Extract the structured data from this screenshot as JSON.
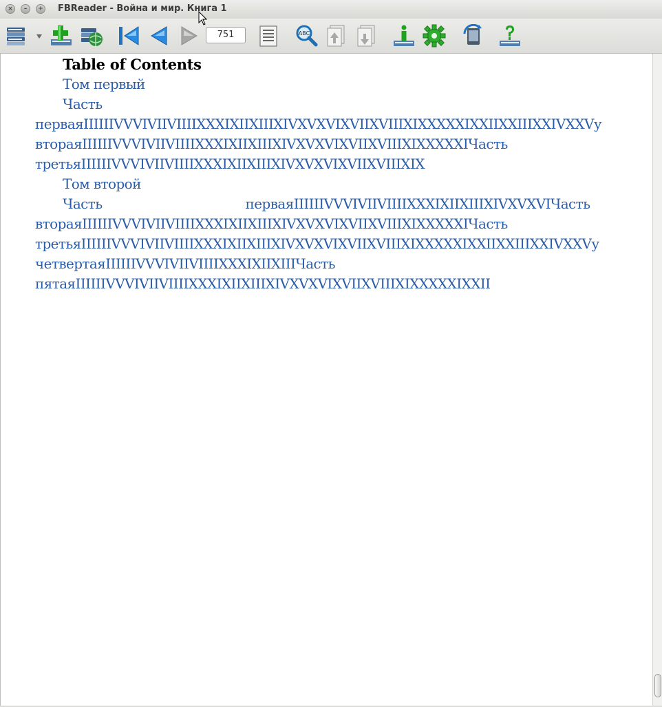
{
  "window": {
    "title": "FBReader - Война и мир. Книга 1",
    "close_glyph": "×",
    "minimize_glyph": "–",
    "maximize_glyph": "+"
  },
  "toolbar": {
    "page_number": "751",
    "icons": [
      "library-icon",
      "menu-arrow-icon",
      "add-book-icon",
      "network-library-icon",
      "go-to-start-icon",
      "back-icon",
      "forward-icon",
      "toc-icon",
      "search-icon",
      "page-up-icon",
      "page-down-icon",
      "book-info-icon",
      "preferences-icon",
      "rotate-icon",
      "help-icon"
    ]
  },
  "toc": {
    "heading": "Table of Contents",
    "tom1": "Том первый",
    "chast": "Часть",
    "l1": "перваяIIIIIIVVVIVIIVIIIIXXXIXIIXIIIXIVXVXVIXVIIXVIIIXIXXXXXIXXIIXXIIIXXIVXXVу",
    "l2": "втораяIIIIIIVVVIVIIVIIIIXXXIXIIXIIIXIVXVXVIXVIIXVIIIXIXXXXXIЧасть",
    "l3": "третьяIIIIIIVVVIVIIVIIIIXXXIXIIXIIIXIVXVXVIXVIIXVIIIXIX",
    "tom2": "Том второй",
    "l4_start": "Часть",
    "l4_end": "перваяIIIIIIVVVIVIIVIIIIXXXIXIIXIIIXIVXVXVIЧасть",
    "l5": "втораяIIIIIIVVVIVIIVIIIIXXXIXIIXIIIXIVXVXVIXVIIXVIIIXIXXXXXIЧасть",
    "l6": "третьяIIIIIIVVVIVIIVIIIIXXXIXIIXIIIXIVXVXVIXVIIXVIIIXIXXXXXIXXIIXXIIIXXIVXXVу",
    "l7": "четвертаяIIIIIIVVVIVIIVIIIIXXXIXIIXIIIЧасть",
    "l8": "пятаяIIIIIIVVVIVIIVIIIIXXXIXIIXIIIXIVXVXVIXVIIXVIIIXIXXXXXIXXII"
  },
  "colors": {
    "link": "#2a5ca8",
    "heading": "#000000"
  }
}
